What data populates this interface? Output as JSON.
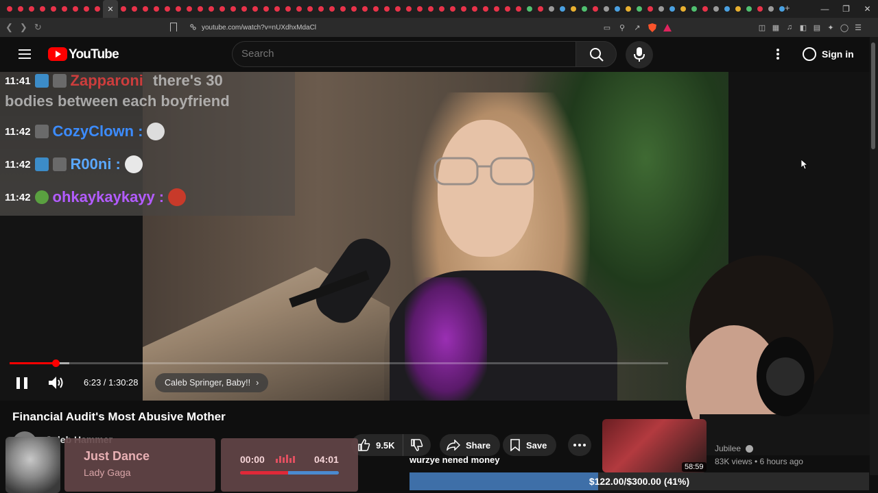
{
  "browser": {
    "url": "youtube.com/watch?v=nUXdhxMdaCl",
    "active_tab_close": "✕",
    "new_tab": "+",
    "window_controls": [
      "—",
      "❐",
      "✕"
    ]
  },
  "header": {
    "logo_text": "YouTube",
    "search_placeholder": "Search",
    "signin_label": "Sign in"
  },
  "chat": {
    "messages": [
      {
        "time": "11:41",
        "user": "Zapparoni",
        "text": "there's 30",
        "text2": "bodies between each boyfriend",
        "color": "#ff4040"
      },
      {
        "time": "11:42",
        "user": "CozyClown",
        "color": "#3c8cff"
      },
      {
        "time": "11:42",
        "user": "R00ni",
        "color": "#5aa8ff"
      },
      {
        "time": "11:42",
        "user": "ohkaykaykayy",
        "color": "#b35cff"
      }
    ]
  },
  "player": {
    "time_display": "6:23 / 1:30:28",
    "chapter": "Caleb Springer, Baby!!",
    "progress_fraction": 0.07
  },
  "video": {
    "title": "Financial Audit's Most Abusive Mother",
    "channel": "Caleb Hammer",
    "likes": "9.5K",
    "share_label": "Share",
    "save_label": "Save"
  },
  "related": {
    "duration": "58:59",
    "channel": "Jubilee",
    "meta": "83K views • 6 hours ago"
  },
  "overlay": {
    "song": "Just Dance",
    "artist": "Lady Gaga",
    "elapsed": "00:00",
    "total": "04:01",
    "donation_message": "wurzye nened money",
    "goal_text": "$122.00/$300.00 (41%)",
    "goal_fraction": 0.41
  },
  "colors": {
    "yt_red": "#ff0000",
    "accent_blue": "#3e6fa8"
  }
}
